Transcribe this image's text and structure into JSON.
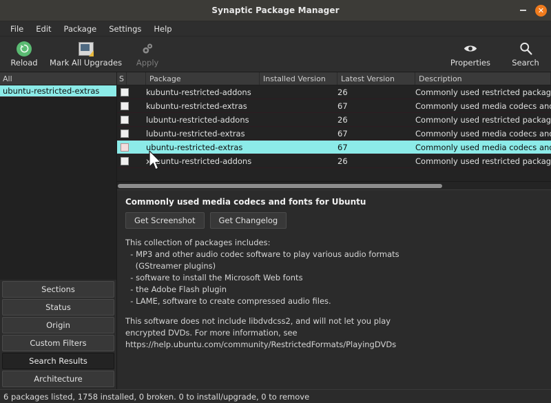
{
  "window": {
    "title": "Synaptic Package Manager",
    "minimize_label": "–",
    "close_label": "✕"
  },
  "menubar": {
    "items": [
      {
        "label": "File"
      },
      {
        "label": "Edit"
      },
      {
        "label": "Package"
      },
      {
        "label": "Settings"
      },
      {
        "label": "Help"
      }
    ]
  },
  "toolbar": {
    "left": [
      {
        "label": "Reload",
        "icon": "reload-icon",
        "enabled": true
      },
      {
        "label": "Mark All Upgrades",
        "icon": "mark-all-upgrades-icon",
        "enabled": true
      },
      {
        "label": "Apply",
        "icon": "apply-gear-icon",
        "enabled": false
      }
    ],
    "right": [
      {
        "label": "Properties",
        "icon": "eye-icon"
      },
      {
        "label": "Search",
        "icon": "search-icon"
      }
    ]
  },
  "sidebar": {
    "filter_header": "All",
    "filter_items": [
      {
        "label": "ubuntu-restricted-extras",
        "selected": true
      }
    ],
    "buttons": [
      {
        "label": "Sections",
        "active": false
      },
      {
        "label": "Status",
        "active": false
      },
      {
        "label": "Origin",
        "active": false
      },
      {
        "label": "Custom Filters",
        "active": false
      },
      {
        "label": "Search Results",
        "active": true
      },
      {
        "label": "Architecture",
        "active": false
      }
    ]
  },
  "package_table": {
    "columns": [
      {
        "label": "S"
      },
      {
        "label": ""
      },
      {
        "label": "Package"
      },
      {
        "label": "Installed Version"
      },
      {
        "label": "Latest Version"
      },
      {
        "label": "Description"
      }
    ],
    "rows": [
      {
        "checked": false,
        "package": "kubuntu-restricted-addons",
        "installed_version": "",
        "latest_version": "26",
        "description": "Commonly used restricted packages f",
        "selected": false
      },
      {
        "checked": false,
        "package": "kubuntu-restricted-extras",
        "installed_version": "",
        "latest_version": "67",
        "description": "Commonly used media codecs and fo",
        "selected": false
      },
      {
        "checked": false,
        "package": "lubuntu-restricted-addons",
        "installed_version": "",
        "latest_version": "26",
        "description": "Commonly used restricted packages f",
        "selected": false
      },
      {
        "checked": false,
        "package": "lubuntu-restricted-extras",
        "installed_version": "",
        "latest_version": "67",
        "description": "Commonly used media codecs and fo",
        "selected": false
      },
      {
        "checked": false,
        "package": "ubuntu-restricted-extras",
        "installed_version": "",
        "latest_version": "67",
        "description": "Commonly used media codecs and fo",
        "selected": true
      },
      {
        "checked": false,
        "package": "xubuntu-restricted-addons",
        "installed_version": "",
        "latest_version": "26",
        "description": "Commonly used restricted packages f",
        "selected": false
      }
    ]
  },
  "details": {
    "title": "Commonly used media codecs and fonts for Ubuntu",
    "screenshot_button": "Get Screenshot",
    "changelog_button": "Get Changelog",
    "lines": [
      "This collection of packages includes:",
      "  - MP3 and other audio codec software to play various audio formats",
      "    (GStreamer plugins)",
      "  - software to install the Microsoft Web fonts",
      "  - the Adobe Flash plugin",
      "  - LAME, software to create compressed audio files.",
      "",
      "This software does not include libdvdcss2, and will not let you play",
      "encrypted DVDs. For more information, see",
      "https://help.ubuntu.com/community/RestrictedFormats/PlayingDVDs"
    ]
  },
  "statusbar": {
    "text": "6 packages listed, 1758 installed, 0 broken. 0 to install/upgrade, 0 to remove"
  },
  "colors": {
    "selection": "#8cebe8",
    "accent_close": "#f07b1d",
    "reload_green": "#5aba72",
    "window_bg": "#2b2b2b"
  }
}
